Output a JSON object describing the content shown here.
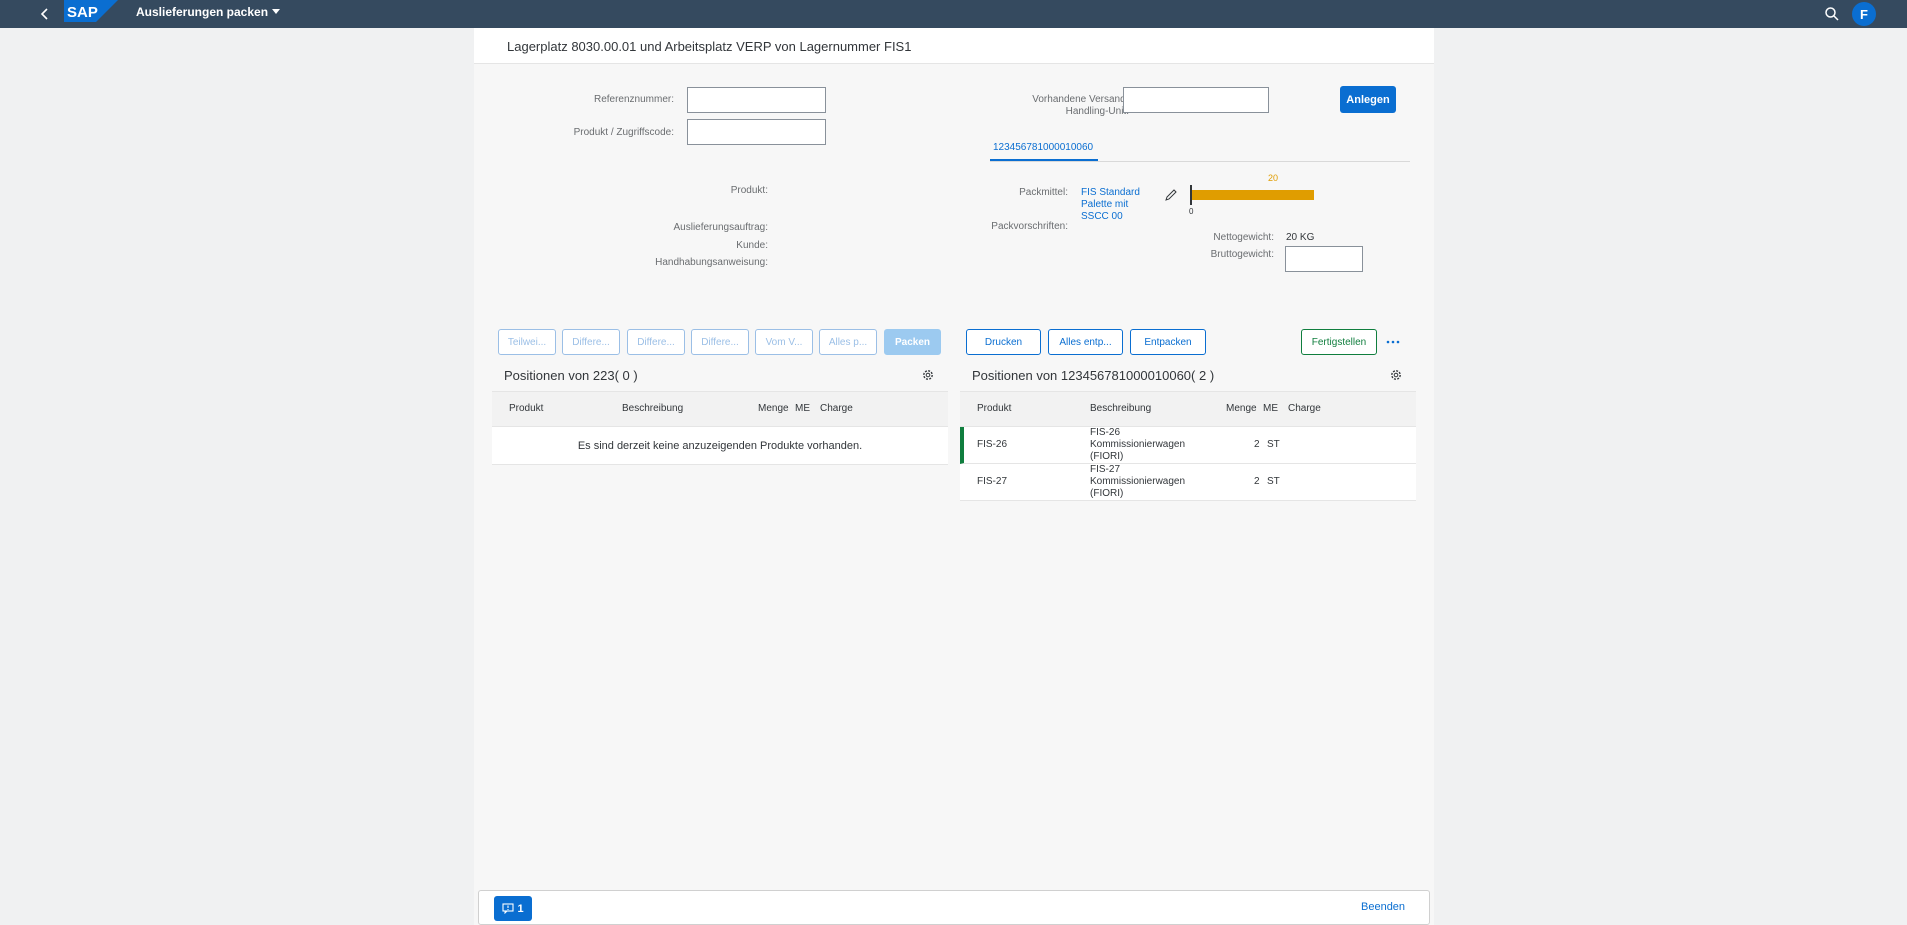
{
  "shell": {
    "logo_text": "SAP",
    "app_title": "Auslieferungen packen",
    "avatar_initial": "F"
  },
  "page": {
    "title": "Lagerplatz 8030.00.01 und Arbeitsplatz VERP von Lagernummer FIS1"
  },
  "form_left": {
    "referenznummer_label": "Referenznummer:",
    "referenznummer_value": "",
    "produkt_code_label": "Produkt / Zugriffscode:",
    "produkt_code_value": "",
    "produkt_label": "Produkt:",
    "auslieferung_label": "Auslieferungsauftrag:",
    "kunde_label": "Kunde:",
    "handhabung_label": "Handhabungsanweisung:"
  },
  "form_right": {
    "versand_label_line1": "Vorhandene Versand-",
    "versand_label_line2": "Handling-Unit:",
    "versand_value": "",
    "anlegen_button": "Anlegen",
    "tab_label": "123456781000010060",
    "packmittel_label": "Packmittel:",
    "packmittel_link": [
      "FIS Standard",
      "Palette mit",
      "SSCC 00"
    ],
    "packvorschriften_label": "Packvorschriften:",
    "gauge_max_label": "20",
    "gauge_min_label": "0",
    "gauge_fill_fraction": 1.0,
    "nettogewicht_label": "Nettogewicht:",
    "nettogewicht_value": "20 KG",
    "bruttogewicht_label": "Bruttogewicht:",
    "bruttogewicht_value": ""
  },
  "toolbar_left": {
    "buttons": [
      "Teilwei...",
      "Differe...",
      "Differe...",
      "Differe...",
      "Vom V...",
      "Alles p..."
    ],
    "packen": "Packen"
  },
  "toolbar_right": {
    "drucken": "Drucken",
    "alles_entpacken": "Alles entp...",
    "entpacken": "Entpacken",
    "fertigstellen": "Fertigstellen"
  },
  "table_left": {
    "title": "Positionen von 223( 0 )",
    "columns": [
      "Produkt",
      "Beschreibung",
      "Menge",
      "ME",
      "Charge"
    ],
    "no_data": "Es sind derzeit keine anzuzeigenden Produkte vorhanden."
  },
  "table_right": {
    "title": "Positionen von 123456781000010060( 2 )",
    "columns": [
      "Produkt",
      "Beschreibung",
      "Menge",
      "ME",
      "Charge"
    ],
    "rows": [
      {
        "produkt": "FIS-26",
        "beschreibung": [
          "FIS-26",
          "Kommissionierwagen",
          "(FIORI)"
        ],
        "menge": "2",
        "me": "ST",
        "charge": ""
      },
      {
        "produkt": "FIS-27",
        "beschreibung": [
          "FIS-27",
          "Kommissionierwagen",
          "(FIORI)"
        ],
        "menge": "2",
        "me": "ST",
        "charge": ""
      }
    ]
  },
  "footer": {
    "message_count": "1",
    "beenden": "Beenden"
  },
  "colors": {
    "shell": "#354a5f",
    "brand": "#0a6ed1",
    "gauge": "#e09d00",
    "accept": "#107e3e"
  }
}
